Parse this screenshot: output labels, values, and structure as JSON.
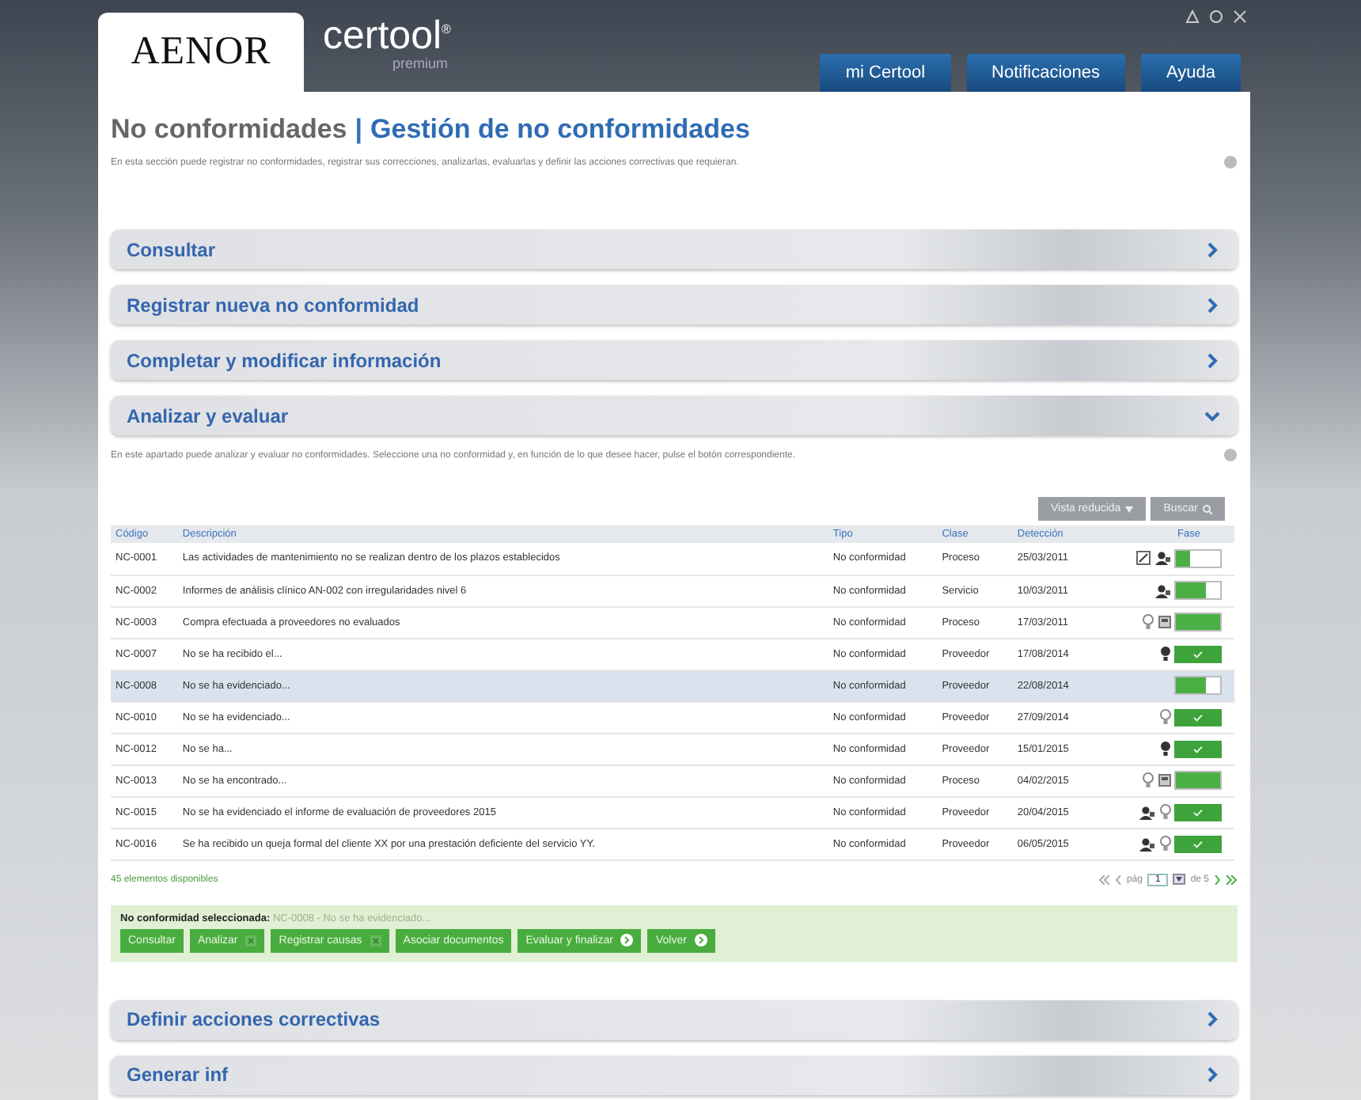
{
  "header": {
    "logo": "AENOR",
    "brand": "certool",
    "brand_mark": "®",
    "brand_sub": "premium",
    "nav": [
      {
        "label": "mi Certool",
        "selected": false
      },
      {
        "label": "Notificaciones",
        "selected": false
      },
      {
        "label": "Ayuda",
        "selected": false
      }
    ]
  },
  "page": {
    "title_section": "No conformidades",
    "title_separator": "|",
    "title_page": "Gestión de no conformidades",
    "description": "En esta sección puede registrar no conformidades, registrar sus correcciones, analizarlas, evaluarlas y definir las acciones correctivas que requieran."
  },
  "sections_top": [
    {
      "label": "Consultar",
      "expanded": false
    },
    {
      "label": "Registrar nueva no conformidad",
      "expanded": false
    },
    {
      "label": "Completar y modificar información",
      "expanded": false
    },
    {
      "label": "Analizar y evaluar",
      "expanded": true
    }
  ],
  "analyze": {
    "description": "En este apartado puede analizar y evaluar no conformidades. Seleccione una no conformidad y, en función de lo que desee hacer, pulse el botón correspondiente.",
    "toolbar": [
      "Vista reducida",
      "Buscar"
    ],
    "table": {
      "columns": [
        "Código",
        "Descripción",
        "Tipo",
        "Clase",
        "Detección",
        "Fase"
      ],
      "rows": [
        {
          "code": "NC-0001",
          "description": "Las actividades de mantenimiento no se realizan dentro de los plazos establecidos",
          "type": "No conformidad",
          "class": "Proceso",
          "date": "25/03/2011",
          "markers": [
            {
              "kind": "edit"
            },
            {
              "kind": "person"
            }
          ],
          "phase": {
            "kind": "progress",
            "level": 0.33
          },
          "selected": false
        },
        {
          "code": "NC-0002",
          "description": "Informes de análisis clínico AN-002 con irregularidades nivel 6",
          "type": "No conformidad",
          "class": "Servicio",
          "date": "10/03/2011",
          "markers": [
            {
              "kind": "person"
            }
          ],
          "phase": {
            "kind": "progress",
            "level": 0.67
          },
          "selected": false
        },
        {
          "code": "NC-0003",
          "description": "Compra efectuada a proveedores no evaluados",
          "type": "No conformidad",
          "class": "Proceso",
          "date": "17/03/2011",
          "markers": [
            {
              "kind": "idea"
            },
            {
              "kind": "calc"
            }
          ],
          "phase": {
            "kind": "progress",
            "level": 1
          },
          "selected": false
        },
        {
          "code": "NC-0007",
          "description": "No se ha recibido el...",
          "type": "No conformidad",
          "class": "Proveedor",
          "date": "17/08/2014",
          "markers": [
            {
              "kind": "idea-solid"
            }
          ],
          "phase": {
            "kind": "done"
          },
          "selected": false
        },
        {
          "code": "NC-0008",
          "description": "No se ha evidenciado...",
          "type": "No conformidad",
          "class": "Proveedor",
          "date": "22/08/2014",
          "markers": [],
          "phase": {
            "kind": "progress",
            "level": 0.67
          },
          "selected": true
        },
        {
          "code": "NC-0010",
          "description": "No se ha evidenciado...",
          "type": "No conformidad",
          "class": "Proveedor",
          "date": "27/09/2014",
          "markers": [
            {
              "kind": "idea"
            }
          ],
          "phase": {
            "kind": "done"
          },
          "selected": false
        },
        {
          "code": "NC-0012",
          "description": "No se ha...",
          "type": "No conformidad",
          "class": "Proveedor",
          "date": "15/01/2015",
          "markers": [
            {
              "kind": "idea-solid"
            }
          ],
          "phase": {
            "kind": "done"
          },
          "selected": false
        },
        {
          "code": "NC-0013",
          "description": "No se ha encontrado...",
          "type": "No conformidad",
          "class": "Proceso",
          "date": "04/02/2015",
          "markers": [
            {
              "kind": "idea"
            },
            {
              "kind": "calc"
            }
          ],
          "phase": {
            "kind": "progress",
            "level": 1
          },
          "selected": false
        },
        {
          "code": "NC-0015",
          "description": "No se ha evidenciado el informe de evaluación de proveedores 2015",
          "type": "No conformidad",
          "class": "Proveedor",
          "date": "20/04/2015",
          "markers": [
            {
              "kind": "person"
            },
            {
              "kind": "idea"
            }
          ],
          "phase": {
            "kind": "done"
          },
          "selected": false
        },
        {
          "code": "NC-0016",
          "description": "Se ha recibido un queja formal del cliente XX por una prestación deficiente del servicio YY.",
          "type": "No conformidad",
          "class": "Proveedor",
          "date": "06/05/2015",
          "markers": [
            {
              "kind": "person"
            },
            {
              "kind": "idea"
            }
          ],
          "phase": {
            "kind": "done"
          },
          "selected": false
        }
      ]
    },
    "count": "45 elementos disponibles",
    "pager": {
      "prefix": "pág",
      "page": "1",
      "suffix": "de 5"
    },
    "selection": {
      "label": "No conformidad seleccionada:",
      "value": "NC-0008 - No se ha evidenciado..."
    },
    "actions": [
      {
        "label": "Consultar",
        "kind": "plain"
      },
      {
        "label": "Analizar",
        "kind": "close"
      },
      {
        "label": "Registrar causas",
        "kind": "close"
      },
      {
        "label": "Asociar documentos",
        "kind": "plain"
      },
      {
        "label": "Evaluar y finalizar",
        "kind": "go"
      },
      {
        "label": "Volver",
        "kind": "go"
      }
    ]
  },
  "sections_bottom": [
    {
      "label": "Definir acciones correctivas",
      "expanded": false
    },
    {
      "label": "Generar inf",
      "expanded": false
    }
  ]
}
